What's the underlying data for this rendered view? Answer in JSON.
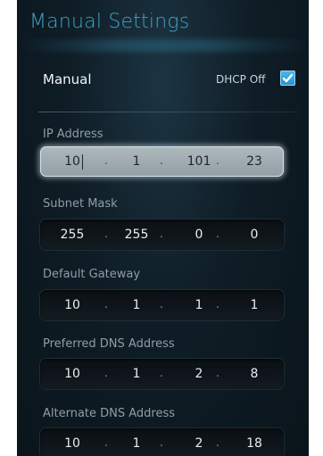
{
  "header": {
    "title": "Manual Settings"
  },
  "mode": {
    "label": "Manual",
    "dhcp_label": "DHCP Off",
    "dhcp_checked": true
  },
  "fields": [
    {
      "label": "IP Address",
      "octets": [
        "10",
        "1",
        "101",
        "23"
      ],
      "focused": true
    },
    {
      "label": "Subnet Mask",
      "octets": [
        "255",
        "255",
        "0",
        "0"
      ],
      "focused": false
    },
    {
      "label": "Default Gateway",
      "octets": [
        "10",
        "1",
        "1",
        "1"
      ],
      "focused": false
    },
    {
      "label": "Preferred DNS Address",
      "octets": [
        "10",
        "1",
        "2",
        "8"
      ],
      "focused": false
    },
    {
      "label": "Alternate DNS Address",
      "octets": [
        "10",
        "1",
        "2",
        "18"
      ],
      "focused": false
    }
  ],
  "separator": "."
}
